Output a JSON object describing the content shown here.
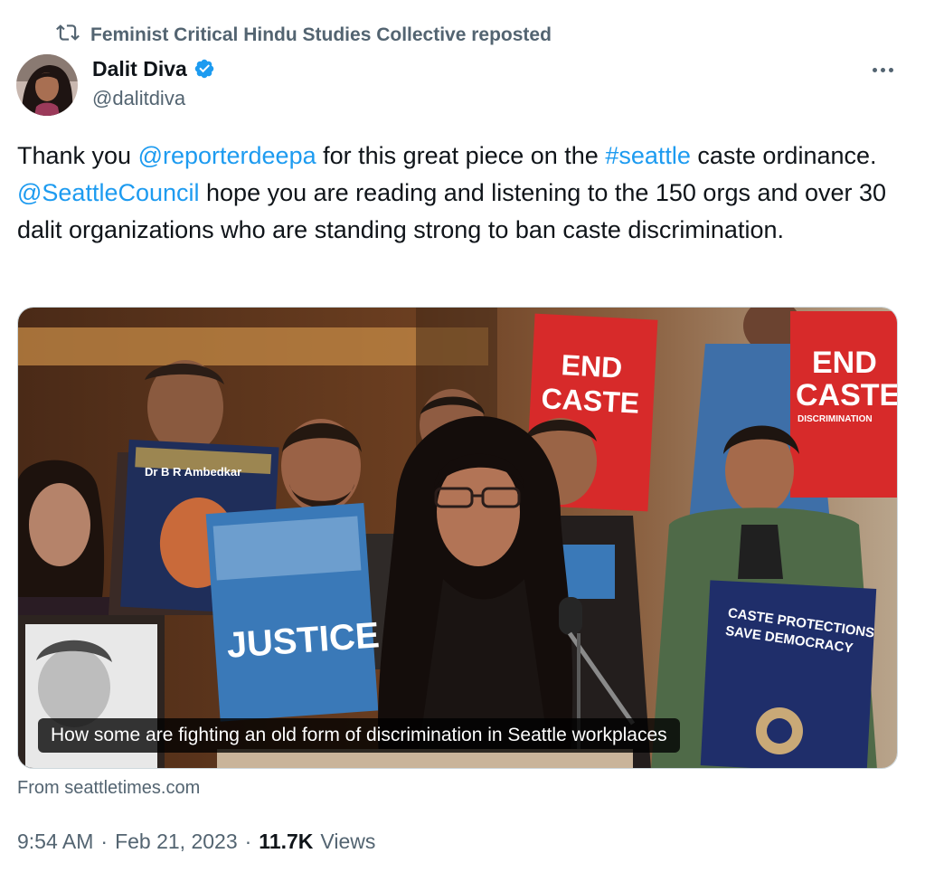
{
  "repost": {
    "text": "Feminist Critical Hindu Studies Collective reposted"
  },
  "author": {
    "name": "Dalit Diva",
    "handle": "@dalitdiva"
  },
  "tweet": {
    "t1": "Thank you ",
    "m1": "@reporterdeepa",
    "t2": " for this great piece on the ",
    "h1": "#seattle",
    "t3": " caste ordinance. ",
    "m2": "@SeattleCouncil",
    "t4": " hope you are reading and listening to the 150 orgs and over 30 dalit organizations who are standing strong to ban caste discrimination."
  },
  "card": {
    "caption": "How some are fighting an old form of discrimination in Seattle workplaces",
    "source": "From seattletimes.com",
    "signs": {
      "end1": "END",
      "caste1": "CASTE",
      "end2": "END",
      "caste2": "CASTE",
      "discrimination2": "DISCRIMINATION",
      "justice": "JUSTICE",
      "protections1": "CASTE PROTECTIONS",
      "protections2": "SAVE DEMOCRACY",
      "ambedkar": "Dr B R Ambedkar"
    }
  },
  "meta": {
    "time": "9:54 AM",
    "sep1": "·",
    "date": "Feb 21, 2023",
    "sep2": "·",
    "views_count": "11.7K",
    "views_label": "Views"
  },
  "colors": {
    "link": "#1d9bf0",
    "verified": "#1d9bf0",
    "muted": "#536471",
    "sign_red": "#d72a2a"
  },
  "icons": [
    "repost-icon",
    "verified-badge-icon",
    "more-icon"
  ]
}
